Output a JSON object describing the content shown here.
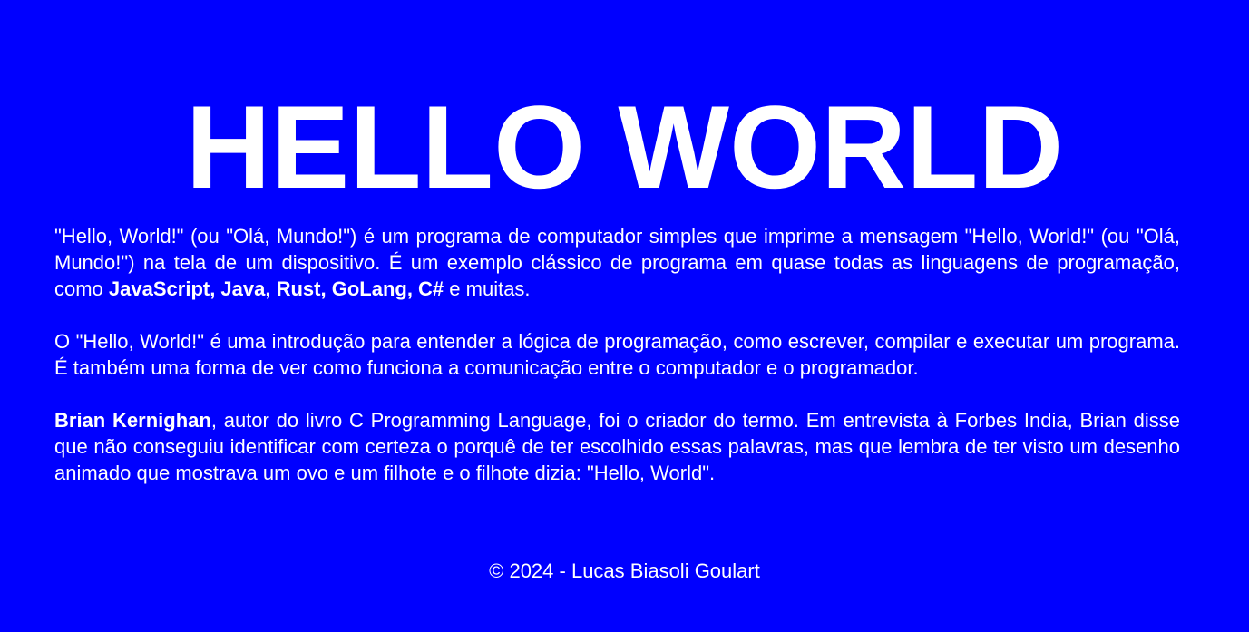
{
  "title": "HELLO WORLD",
  "paragraph1": {
    "text_a": "\"Hello, World!\" (ou \"Olá, Mundo!\") é um programa de computador simples que imprime a mensagem \"Hello, World!\" (ou \"Olá, Mundo!\") na tela de um dispositivo. É um exemplo clássico de programa em quase todas as linguagens de programação, como ",
    "languages": "JavaScript, Java, Rust, GoLang, C#",
    "text_b": " e muitas."
  },
  "paragraph2": {
    "text": "O \"Hello, World!\" é uma introdução para entender a lógica de programação, como escrever, compilar e executar um programa. É também uma forma de ver como funciona a comunicação entre o computador e o programador."
  },
  "paragraph3": {
    "name": "Brian Kernighan",
    "text": ", autor do livro C Programming Language, foi o criador do termo. Em entrevista à Forbes India, Brian disse que não conseguiu identificar com certeza o porquê de ter escolhido essas palavras, mas que lembra de ter visto um desenho animado que mostrava um ovo e um filhote e o filhote dizia: \"Hello, World\"."
  },
  "footer": "© 2024 - Lucas Biasoli Goulart",
  "colors": {
    "background": "#0000ff",
    "text": "#ffffff"
  }
}
